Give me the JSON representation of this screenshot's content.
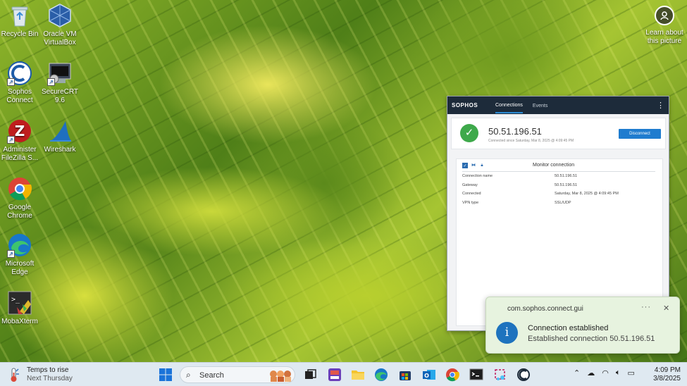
{
  "desktop": {
    "icons": [
      {
        "label": "Recycle Bin",
        "icon": "recycle-bin-icon"
      },
      {
        "label": "Oracle VM VirtualBox",
        "icon": "virtualbox-icon"
      },
      {
        "label": "Sophos Connect",
        "icon": "sophos-connect-icon"
      },
      {
        "label": "SecureCRT 9.6",
        "icon": "securecrt-icon"
      },
      {
        "label": "Administer FileZilla S...",
        "icon": "filezilla-icon"
      },
      {
        "label": "Wireshark",
        "icon": "wireshark-icon"
      },
      {
        "label": "Google Chrome",
        "icon": "chrome-icon"
      },
      {
        "label": "Microsoft Edge",
        "icon": "edge-icon"
      },
      {
        "label": "MobaXterm",
        "icon": "mobaxterm-icon"
      }
    ],
    "learn_about": "Learn about this picture"
  },
  "sophos": {
    "logo": "SOPHOS",
    "tabs": [
      "Connections",
      "Events"
    ],
    "connection_ip": "50.51.196.51",
    "connection_sub": "Connected since Saturday, Mar 8, 2025 @ 4:09:45 PM",
    "disconnect_label": "Disconnect",
    "monitor_title": "Monitor connection",
    "rows": [
      {
        "key": "Connection name",
        "value": "50.51.196.51"
      },
      {
        "key": "Gateway",
        "value": "50.51.196.51"
      },
      {
        "key": "Connected",
        "value": "Saturday, Mar 8, 2025 @ 4:09:45 PM"
      },
      {
        "key": "VPN type",
        "value": "SSL/UDP"
      }
    ]
  },
  "toast": {
    "app": "com.sophos.connect.gui",
    "title": "Connection established",
    "body": "Established connection 50.51.196.51"
  },
  "taskbar": {
    "weather_line1": "Temps to rise",
    "weather_line2": "Next Thursday",
    "search_placeholder": "Search",
    "apps": [
      "start-icon",
      "search",
      "task-view-icon",
      "news-icon",
      "file-explorer-icon",
      "edge-icon",
      "store-icon",
      "outlook-icon",
      "chrome-icon",
      "terminal-icon",
      "snipping-tool-icon",
      "sophos-icon"
    ],
    "time": "4:09 PM",
    "date": "3/8/2025"
  },
  "colors": {
    "sophos_header": "#1d2b3a",
    "accent_blue": "#1f7ccf",
    "success_green": "#3ea94b",
    "toast_bg": "#e7f3df",
    "taskbar_bg": "#dfe9f1"
  }
}
